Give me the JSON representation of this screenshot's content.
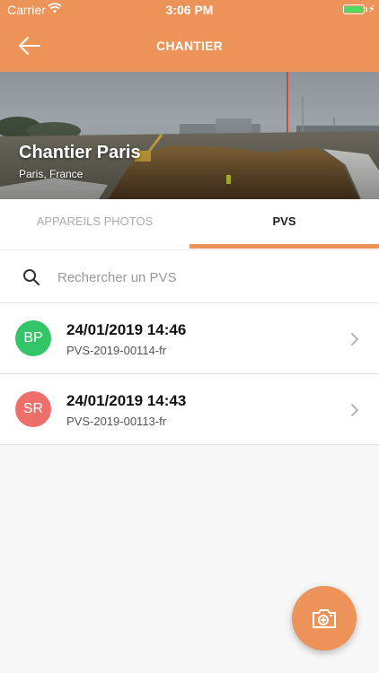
{
  "status_bar": {
    "carrier": "Carrier",
    "time": "3:06 PM",
    "battery_level": 1.0
  },
  "nav": {
    "title": "CHANTIER"
  },
  "hero": {
    "site_name": "Chantier Paris",
    "location": "Paris, France"
  },
  "tabs": [
    {
      "label": "APPAREILS PHOTOS",
      "active": false
    },
    {
      "label": "PVS",
      "active": true
    }
  ],
  "search": {
    "placeholder": "Rechercher un PVS",
    "value": ""
  },
  "pvs": [
    {
      "initials": "BP",
      "avatar_color": "#34c46a",
      "date": "24/01/2019 14:46",
      "reference": "PVS-2019-00114-fr"
    },
    {
      "initials": "SR",
      "avatar_color": "#ee6f6a",
      "date": "24/01/2019 14:43",
      "reference": "PVS-2019-00113-fr"
    }
  ],
  "colors": {
    "accent": "#ec935a",
    "background": "#f7f7f7"
  },
  "fab": {
    "icon": "add-photo-icon"
  }
}
